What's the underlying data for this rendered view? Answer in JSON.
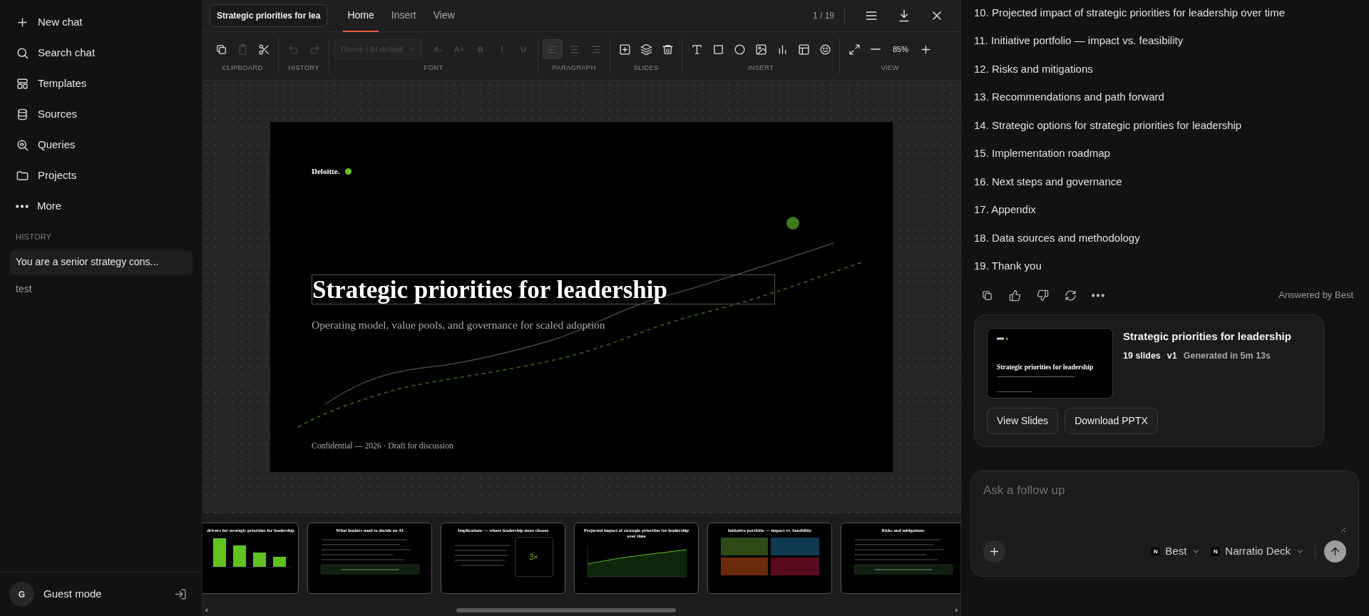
{
  "sidebar": {
    "nav": [
      {
        "kind": "plus",
        "label": "New chat"
      },
      {
        "kind": "search",
        "label": "Search chat"
      },
      {
        "kind": "templates",
        "label": "Templates"
      },
      {
        "kind": "database",
        "label": "Sources"
      },
      {
        "kind": "queries",
        "label": "Queries"
      },
      {
        "kind": "folder",
        "label": "Projects"
      },
      {
        "kind": "more",
        "label": "More"
      }
    ],
    "history_label": "HISTORY",
    "history": [
      {
        "label": "You are a senior strategy cons...",
        "selected": true
      },
      {
        "label": "test",
        "selected": false
      }
    ],
    "user": {
      "avatar": "G",
      "name": "Guest mode"
    }
  },
  "editor": {
    "title_field": "Strategic priorities for lea",
    "tabs": [
      {
        "label": "Home",
        "selected": true
      },
      {
        "label": "Insert",
        "selected": false
      },
      {
        "label": "View",
        "selected": false
      }
    ],
    "page_counter": "1 / 19",
    "toolbar": [
      {
        "label": "CLIPBOARD",
        "tools": [
          {
            "kind": "copy",
            "disabled": false
          },
          {
            "kind": "paste",
            "disabled": true
          },
          {
            "kind": "cut",
            "disabled": false
          }
        ]
      },
      {
        "label": "HISTORY",
        "tools": [
          {
            "kind": "undo",
            "disabled": true
          },
          {
            "kind": "redo",
            "disabled": true
          }
        ]
      },
      {
        "label": "FONT",
        "tools": [
          {
            "kind": "select",
            "text": "Theme / AI default",
            "disabled": true
          },
          {
            "kind": "text",
            "text": "A-",
            "disabled": true
          },
          {
            "kind": "text",
            "text": "A+",
            "disabled": true
          },
          {
            "kind": "text",
            "text": "B",
            "disabled": true
          },
          {
            "kind": "text",
            "text": "I",
            "disabled": true
          },
          {
            "kind": "text",
            "text": "U",
            "disabled": true
          }
        ]
      },
      {
        "label": "PARAGRAPH",
        "tools": [
          {
            "kind": "align-left",
            "disabled": true,
            "selected": true
          },
          {
            "kind": "align-center",
            "disabled": true,
            "selected": false
          },
          {
            "kind": "align-right",
            "disabled": true,
            "selected": false
          }
        ]
      },
      {
        "label": "SLIDES",
        "tools": [
          {
            "kind": "add-slide",
            "disabled": false
          },
          {
            "kind": "layers",
            "disabled": false
          },
          {
            "kind": "trash",
            "disabled": false
          }
        ]
      },
      {
        "label": "INSERT",
        "tools": [
          {
            "kind": "text-tool",
            "disabled": false
          },
          {
            "kind": "square",
            "disabled": false
          },
          {
            "kind": "circle",
            "disabled": false
          },
          {
            "kind": "image",
            "disabled": false
          },
          {
            "kind": "chart",
            "disabled": false
          },
          {
            "kind": "table",
            "disabled": false
          },
          {
            "kind": "emoji",
            "disabled": false
          }
        ]
      },
      {
        "label": "VIEW",
        "tools": [
          {
            "kind": "expand",
            "disabled": false
          },
          {
            "kind": "zoom-out",
            "disabled": false
          },
          {
            "kind": "value",
            "text": "85%",
            "disabled": false
          },
          {
            "kind": "zoom-in",
            "disabled": false
          }
        ]
      }
    ],
    "slide": {
      "logo": "Deloitte.",
      "title": "Strategic priorities for leadership",
      "title_selected": true,
      "subtitle": "Operating model, value pools, and governance for scaled adoption",
      "footer": "Confidential — 2026 · Draft for discussion"
    },
    "thumbnails": [
      {
        "kind": "bars",
        "title": "drivers for strategic priorities for leadership"
      },
      {
        "kind": "bullets",
        "title": "What leaders need to decide on AI"
      },
      {
        "kind": "callout",
        "title": "Implications — where leadership must choose",
        "figure": "3×"
      },
      {
        "kind": "line",
        "title": "Projected impact of strategic priorities for leadership over time"
      },
      {
        "kind": "matrix",
        "title": "Initiative portfolio — impact vs. feasibility"
      },
      {
        "kind": "bullets",
        "title": "Risks and mitigations"
      }
    ]
  },
  "chat": {
    "outline": [
      "10. Projected impact of strategic priorities for leadership over time",
      "11. Initiative portfolio — impact vs. feasibility",
      "12. Risks and mitigations",
      "13. Recommendations and path forward",
      "14. Strategic options for strategic priorities for leadership",
      "15. Implementation roadmap",
      "16. Next steps and governance",
      "17. Appendix",
      "18. Data sources and methodology",
      "19. Thank you"
    ],
    "actions": [
      {
        "kind": "copy"
      },
      {
        "kind": "thumbs-up"
      },
      {
        "kind": "thumbs-down"
      },
      {
        "kind": "refresh"
      },
      {
        "kind": "more"
      }
    ],
    "answered_by": "Answered by Best",
    "deck_card": {
      "thumb_title": "Strategic priorities for leadership",
      "title": "Strategic priorities for leadership",
      "slides": "19 slides",
      "version": "v1",
      "generated": "Generated in 5m 13s",
      "buttons": [
        "View Slides",
        "Download PPTX"
      ]
    },
    "composer": {
      "placeholder": "Ask a follow up",
      "selectors": [
        {
          "badge": "N",
          "label": "Best"
        },
        {
          "badge": "N",
          "label": "Narratio Deck"
        }
      ]
    }
  }
}
